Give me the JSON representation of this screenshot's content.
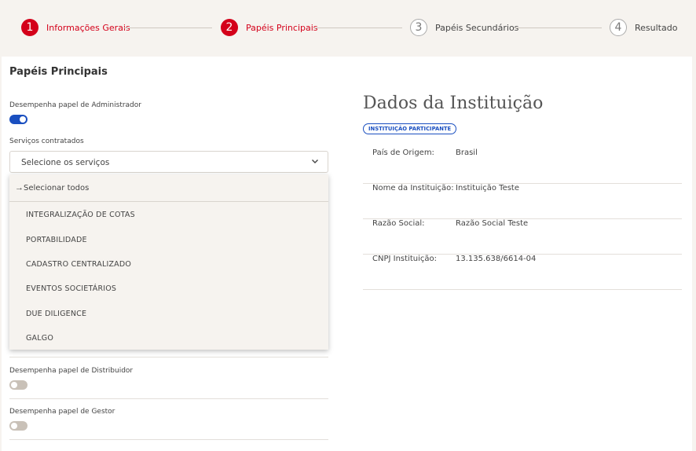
{
  "stepper": {
    "steps": [
      {
        "number": "1",
        "label": "Informações Gerais",
        "state": "active"
      },
      {
        "number": "2",
        "label": "Papéis Principais",
        "state": "active"
      },
      {
        "number": "3",
        "label": "Papéis Secundários",
        "state": "inactive"
      },
      {
        "number": "4",
        "label": "Resultado",
        "state": "inactive"
      }
    ]
  },
  "form": {
    "title": "Papéis Principais",
    "administrador": {
      "label": "Desempenha papel de Administrador",
      "enabled": true
    },
    "servicos": {
      "label": "Serviços contratados",
      "placeholder": "Selecione os serviços",
      "select_all": "Selecionar todos",
      "options": [
        "INTEGRALIZAÇÃO DE COTAS",
        "PORTABILIDADE",
        "CADASTRO CENTRALIZADO",
        "EVENTOS SOCIETÁRIOS",
        "DUE DILIGENCE",
        "GALGO"
      ]
    },
    "distribuidor": {
      "label": "Desempenha papel de Distribuidor",
      "enabled": false
    },
    "gestor": {
      "label": "Desempenha papel de Gestor",
      "enabled": false
    }
  },
  "instituicao": {
    "title": "Dados da Instituição",
    "badge": "INSTITUIÇÃO PARTICIPANTE",
    "rows": [
      {
        "label": "País de Origem:",
        "value": "Brasil"
      },
      {
        "label": "Nome da Instituição:",
        "value": "Instituição Teste"
      },
      {
        "label": "Razão Social:",
        "value": "Razão Social Teste"
      },
      {
        "label": "CNPJ Instituição:",
        "value": "13.135.638/6614-04"
      }
    ]
  },
  "colors": {
    "accent_red": "#d4001a",
    "toggle_on": "#1a4fc0",
    "toggle_off": "#c9c1b8",
    "background": "#f6f3ef"
  }
}
